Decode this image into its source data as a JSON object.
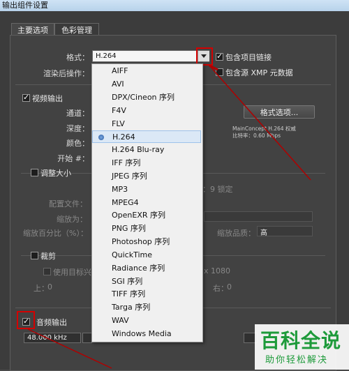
{
  "window": {
    "title": "输出组件设置"
  },
  "tabs": [
    {
      "label": "主要选项"
    },
    {
      "label": "色彩管理"
    }
  ],
  "format": {
    "label": "格式：",
    "value": "H.264"
  },
  "post_render": {
    "label": "渲染后操作："
  },
  "include_project_link": {
    "label": "包含项目链接",
    "checked": true
  },
  "include_source_xmp": {
    "label": "包含源 XMP 元数据",
    "checked": false
  },
  "video_output": {
    "label": "视频输出",
    "checked": true,
    "channel_label": "通道：",
    "depth_label": "深度：",
    "color_label": "颜色：",
    "start_label": "开始 #：",
    "format_options_button": "格式选项...",
    "codec_info": "MainConcept H.264 权威",
    "bitrate_info": "比特率：0.60 Mbps"
  },
  "resize": {
    "label": "调整大小",
    "checked": false,
    "lock_text": "：9 锁定",
    "preset_label": "配置文件：",
    "resize_to_label": "缩放为：",
    "resize_percent_label": "缩放百分比（%）：",
    "quality_label": "缩放品质：",
    "quality_value": "高"
  },
  "crop": {
    "label": "裁剪",
    "checked": false,
    "use_roi_label": "使用目标兴",
    "size_text": "x 1080",
    "top_label": "上：",
    "top_value": "0",
    "right_label": "右：",
    "right_value": "0"
  },
  "audio_output": {
    "label": "音频输出",
    "checked": true,
    "sample_rate": "48.000 kHz"
  },
  "dropdown_options": [
    "AIFF",
    "AVI",
    "DPX/Cineon 序列",
    "F4V",
    "FLV",
    "H.264",
    "H.264 Blu-ray",
    "IFF 序列",
    "JPEG 序列",
    "MP3",
    "MPEG4",
    "OpenEXR 序列",
    "PNG 序列",
    "Photoshop 序列",
    "QuickTime",
    "Radiance 序列",
    "SGI 序列",
    "TIFF 序列",
    "Targa 序列",
    "WAV",
    "Windows Media"
  ],
  "dropdown_selected_index": 5,
  "watermark": {
    "title": "百科全说",
    "subtitle": "助你轻松解决"
  },
  "colors": {
    "highlight": "#d40000",
    "selection": "#dbe8f6",
    "brand_green": "#1d9a3a"
  }
}
